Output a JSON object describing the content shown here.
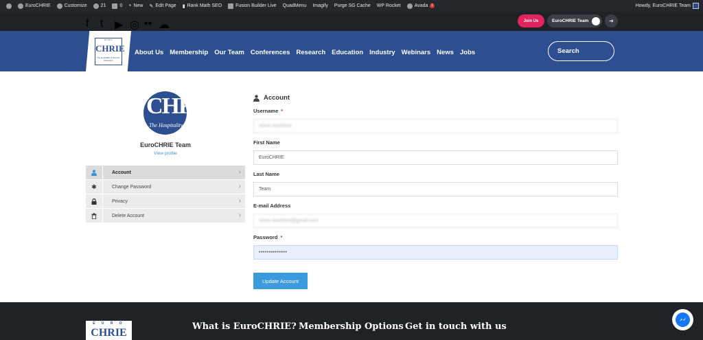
{
  "wp_admin_bar": {
    "site_name": "EuroCHRIE",
    "customize": "Customize",
    "updates_count": "21",
    "comments_count": "0",
    "new": "New",
    "edit_page": "Edit Page",
    "rank_math": "Rank Math SEO",
    "fusion_builder": "Fusion Builder Live",
    "quadmenu": "QuadMenu",
    "imagify": "Imagify",
    "purge_cache": "Purge SG Cache",
    "wp_rocket": "WP Rocket",
    "avada": "Avada",
    "avada_badge": "1",
    "howdy": "Howdy, EuroCHRIE Team"
  },
  "top_bar": {
    "social_icons": [
      "facebook-icon",
      "twitter-icon",
      "youtube-icon",
      "instagram-icon",
      "flickr-icon",
      "soundcloud-icon"
    ],
    "join_label": "Join Us",
    "team_label": "EuroCHRIE Team"
  },
  "nav": {
    "logo_text": "CHRIE",
    "logo_top": "E U R O",
    "logo_sub": "The Hospitality & Tourism Educators",
    "items": [
      "About Us",
      "Membership",
      "Our Team",
      "Conferences",
      "Research",
      "Education",
      "Industry",
      "Webinars",
      "News",
      "Jobs"
    ],
    "search_placeholder": "Search"
  },
  "profile": {
    "avatar_text": "CHR",
    "avatar_sub": "The Hospitality & Tourism E",
    "name": "EuroCHRIE Team",
    "view_profile": "View profile",
    "menu": [
      {
        "label": "Account",
        "icon": "user-icon",
        "active": true
      },
      {
        "label": "Change Password",
        "icon": "asterisk-icon",
        "active": false
      },
      {
        "label": "Privacy",
        "icon": "lock-icon",
        "active": false
      },
      {
        "label": "Delete Account",
        "icon": "trash-icon",
        "active": false
      }
    ]
  },
  "form": {
    "title": "Account",
    "username_label": "Username",
    "username_value": "steve.stashford",
    "first_name_label": "First Name",
    "first_name_value": "EuroCHRIE",
    "last_name_label": "Last Name",
    "last_name_value": "Team",
    "email_label": "E-mail Address",
    "email_value": "steve.stashford@gmail.com",
    "password_label": "Password",
    "password_value": "••••••••••••••",
    "required_marker": "*",
    "submit_label": "Update Account"
  },
  "footer": {
    "logo_top": "E U R O",
    "logo_text": "CHRIE",
    "headings": [
      "What is EuroCHRIE?",
      "Membership Options",
      "Get in touch with us"
    ]
  },
  "colors": {
    "brand_blue": "#2d4f91",
    "pink": "#e0245e",
    "button_blue": "#3b9bdc",
    "dark": "#1f2227"
  }
}
